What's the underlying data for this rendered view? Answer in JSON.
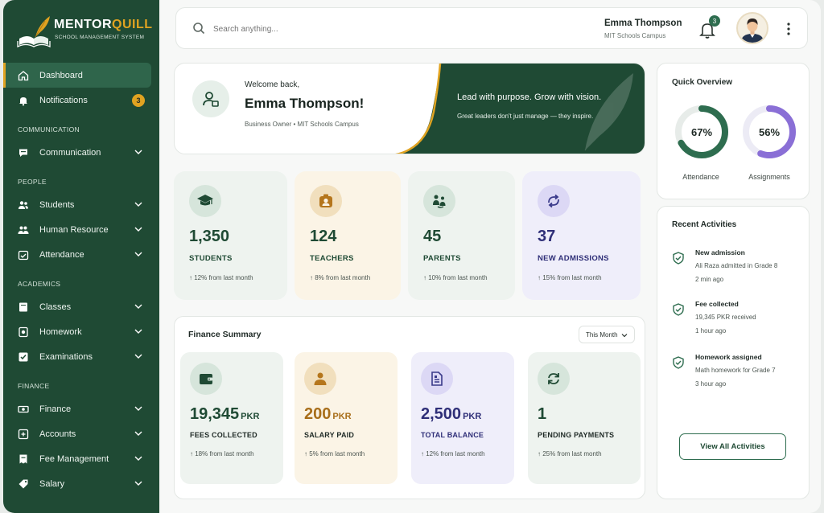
{
  "brand": {
    "name_prefix": "MENTOR",
    "name_suffix": "QUILL",
    "tagline": "SCHOOL MANAGEMENT SYSTEM",
    "primary": "#1f4a34",
    "accent": "#e0a321"
  },
  "sidebar": {
    "dashboard": "Dashboard",
    "notifications": "Notifications",
    "notifications_count": "3",
    "sections": {
      "communication": "COMMUNICATION",
      "people": "PEOPLE",
      "academics": "ACADEMICS",
      "finance": "FINANCE"
    },
    "items": {
      "communication": "Communication",
      "students": "Students",
      "human_resource": "Human Resource",
      "attendance": "Attendance",
      "classes": "Classes",
      "homework": "Homework",
      "examinations": "Examinations",
      "finance": "Finance",
      "accounts": "Accounts",
      "fee_management": "Fee Management",
      "salary": "Salary"
    }
  },
  "header": {
    "search_placeholder": "Search anything...",
    "user_name": "Emma Thompson",
    "user_campus": "MIT Schools Campus",
    "notification_count": "3"
  },
  "welcome": {
    "greeting": "Welcome back,",
    "name": "Emma Thompson!",
    "meta": "Business Owner  •  MIT Schools Campus",
    "banner_line1": "Lead with purpose. Grow with vision.",
    "banner_line2": "Great leaders don't just manage — they inspire."
  },
  "stats": [
    {
      "value": "1,350",
      "label": "STUDENTS",
      "delta": "↑ 12% from last month"
    },
    {
      "value": "124",
      "label": "TEACHERS",
      "delta": "↑ 8% from last month"
    },
    {
      "value": "45",
      "label": "PARENTS",
      "delta": "↑ 10% from last month"
    },
    {
      "value": "37",
      "label": "NEW ADMISSIONS",
      "delta": "↑ 15% from last month"
    }
  ],
  "finance": {
    "title": "Finance Summary",
    "period": "This Month",
    "cards": [
      {
        "value": "19,345",
        "unit": "PKR",
        "label": "FEES COLLECTED",
        "delta": "↑ 18% from last month"
      },
      {
        "value": "200",
        "unit": "PKR",
        "label": "SALARY PAID",
        "delta": "↑ 5% from last month"
      },
      {
        "value": "2,500",
        "unit": "PKR",
        "label": "TOTAL BALANCE",
        "delta": "↑ 12% from last month"
      },
      {
        "value": "1",
        "unit": "",
        "label": "PENDING PAYMENTS",
        "delta": "↑ 25% from last month"
      }
    ]
  },
  "quick_overview": {
    "title": "Quick Overview",
    "attendance": {
      "value": "67%",
      "label": "Attendance",
      "fraction": 0.67,
      "color": "#2e6d4f"
    },
    "assignments": {
      "value": "56%",
      "label": "Assignments",
      "fraction": 0.56,
      "color": "#8a6fd6"
    }
  },
  "recent": {
    "title": "Recent Activities",
    "items": [
      {
        "title": "New admission",
        "detail": "Ali Raza admitted in Grade 8",
        "time": "2 min ago"
      },
      {
        "title": "Fee collected",
        "detail": "19,345 PKR received",
        "time": "1 hour ago"
      },
      {
        "title": "Homework assigned",
        "detail": "Math homework for Grade 7",
        "time": "3 hour ago"
      }
    ],
    "button": "View All Activities"
  }
}
